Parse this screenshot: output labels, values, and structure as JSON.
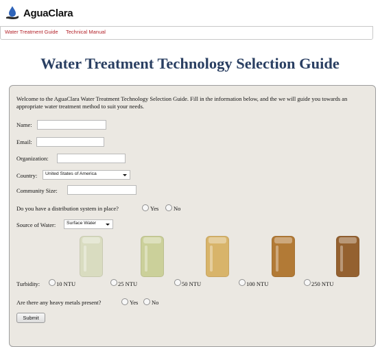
{
  "brand": {
    "logo_text": "AguaClara",
    "logo_icon": "water-drop-hand-icon"
  },
  "nav": {
    "items": [
      "Water Treatment Guide",
      "Technical Manual"
    ],
    "link_color": "#b3222a"
  },
  "page": {
    "title": "Water Treatment Technology Selection Guide",
    "title_color": "#2a3f62"
  },
  "form": {
    "intro": "Welcome to the AguaClara Water Treatment Technology Selection Guide. Fill in the information below, and the we will guide you towards an appropriate water treatment method to suit your needs.",
    "labels": {
      "name": "Name:",
      "email": "Email:",
      "organization": "Organization:",
      "country": "Country:",
      "community_size": "Community Size:",
      "distribution": "Do you have a distribution system in place?",
      "source": "Source of Water:",
      "turbidity": "Turbidity:",
      "metals": "Are there any heavy metals present?"
    },
    "values": {
      "name": "",
      "email": "",
      "organization": "",
      "community_size": ""
    },
    "country_selected": "United States of America",
    "source_selected": "Surface Water",
    "yes_no": [
      "Yes",
      "No"
    ],
    "turbidity_options": [
      "10 NTU",
      "25 NTU",
      "50 NTU",
      "100 NTU",
      "250 NTU"
    ],
    "jar_colors": [
      "#d9dcc0",
      "#cbd09a",
      "#d8b46a",
      "#b27a36",
      "#946130"
    ],
    "submit_label": "Submit"
  }
}
